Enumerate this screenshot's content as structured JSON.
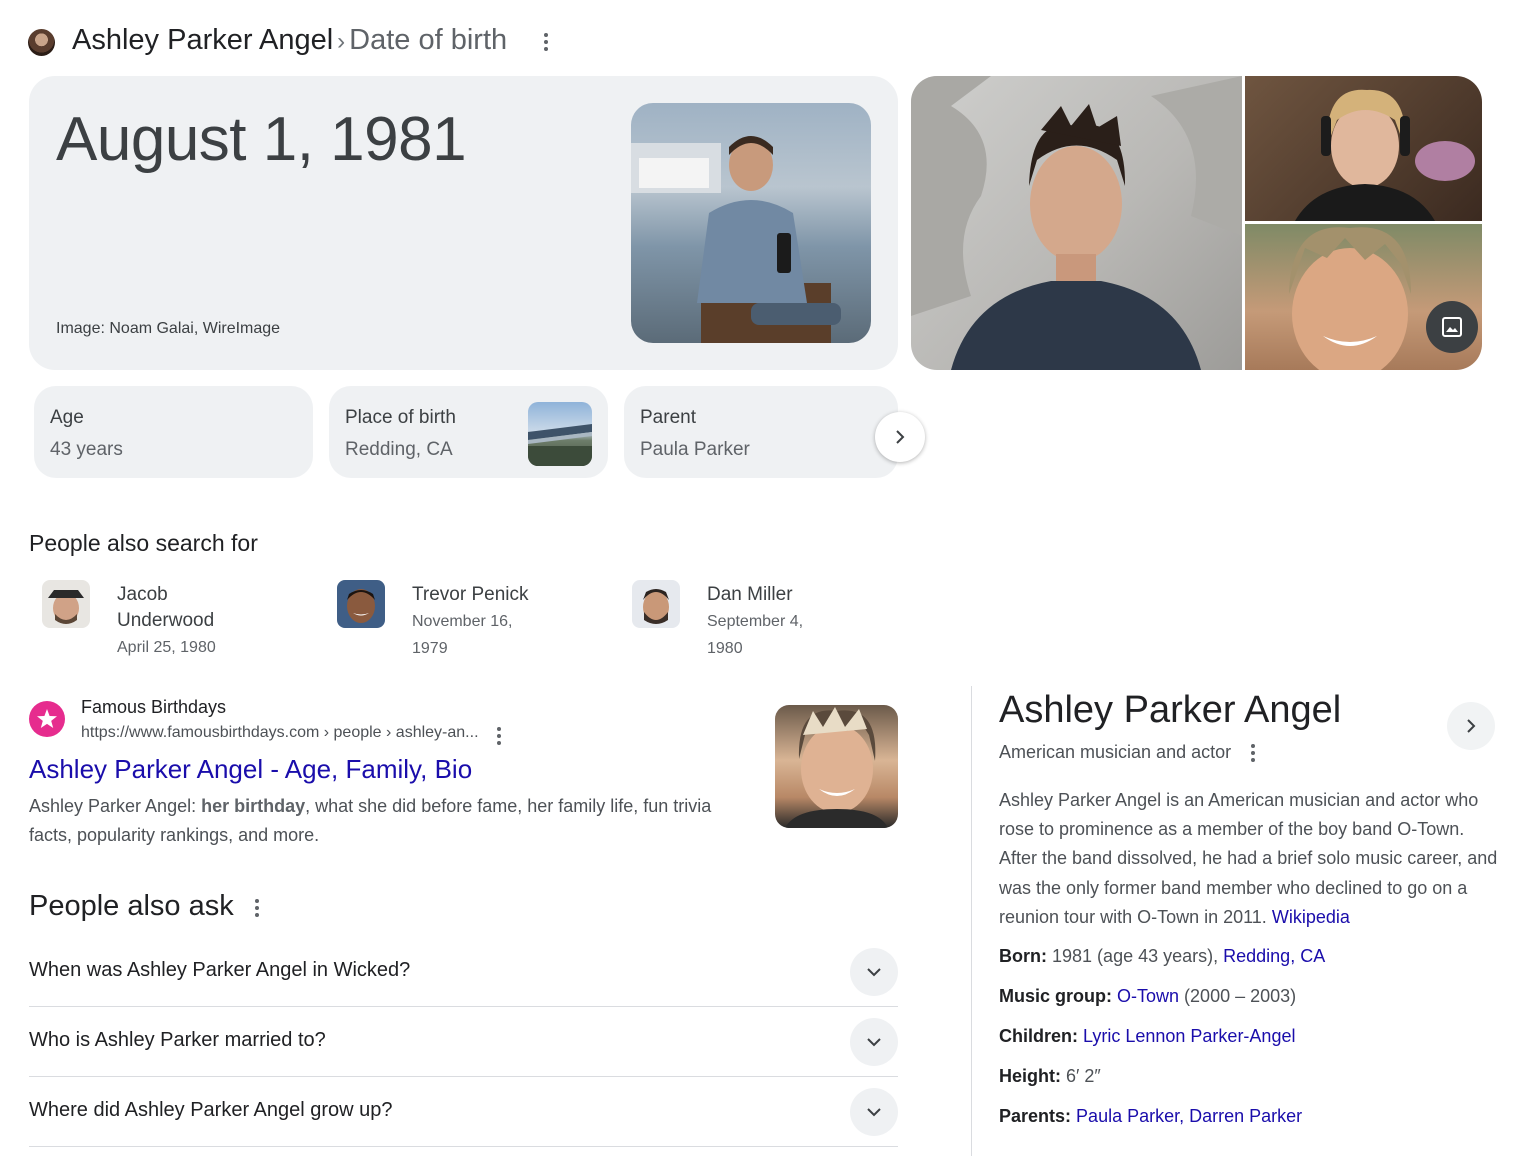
{
  "header": {
    "entity": "Ashley Parker Angel",
    "separator": "›",
    "attribute": "Date of birth"
  },
  "answer": {
    "date": "August 1, 1981",
    "image_credit": "Image: Noam Galai, WireImage"
  },
  "facts": [
    {
      "label": "Age",
      "value": "43 years"
    },
    {
      "label": "Place of birth",
      "value": "Redding, CA"
    },
    {
      "label": "Parent",
      "value": "Paula Parker"
    }
  ],
  "people_also_search": {
    "title": "People also search for",
    "people": [
      {
        "name": "Jacob Underwood",
        "date": "April 25, 1980"
      },
      {
        "name": "Trevor Penick",
        "date": "November 16, 1979"
      },
      {
        "name": "Dan Miller",
        "date": "September 4, 1980"
      }
    ]
  },
  "result": {
    "site_name": "Famous Birthdays",
    "url": "https://www.famousbirthdays.com › people › ashley-an...",
    "title": "Ashley Parker Angel - Age, Family, Bio",
    "snippet_prefix": "Ashley Parker Angel: ",
    "snippet_bold": "her birthday",
    "snippet_rest": ", what she did before fame, her family life, fun trivia facts, popularity rankings, and more."
  },
  "people_also_ask": {
    "title": "People also ask",
    "questions": [
      "When was Ashley Parker Angel in Wicked?",
      "Who is Ashley Parker married to?",
      "Where did Ashley Parker Angel grow up?"
    ]
  },
  "knowledge_panel": {
    "title": "Ashley Parker Angel",
    "subtitle": "American musician and actor",
    "description": "Ashley Parker Angel is an American musician and actor who rose to prominence as a member of the boy band O-Town. After the band dissolved, he had a brief solo music career, and was the only former band member who declined to go on a reunion tour with O-Town in 2011.",
    "source_link": "Wikipedia",
    "born_label": "Born:",
    "born_text": "1981 (age 43 years),",
    "born_link": "Redding, CA",
    "music_group_label": "Music group:",
    "music_group_link": "O-Town",
    "music_group_years": "(2000 – 2003)",
    "children_label": "Children:",
    "children_link": "Lyric Lennon Parker-Angel",
    "height_label": "Height:",
    "height_value": "6′ 2″",
    "parents_label": "Parents:",
    "parents_link": "Paula Parker, Darren Parker"
  }
}
